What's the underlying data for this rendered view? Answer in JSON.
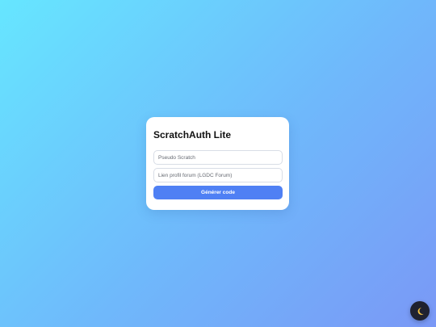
{
  "card": {
    "title": "ScratchAuth Lite",
    "username_placeholder": "Pseudo Scratch",
    "profile_link_placeholder": "Lien profil forum (LGDC Forum)",
    "submit_label": "Générer code"
  },
  "theme_toggle": {
    "icon": "moon-icon",
    "icon_color": "#f5c542"
  },
  "colors": {
    "background_start": "#66e6ff",
    "background_end": "#7a98f6",
    "accent": "#4f80f4",
    "toggle_bg": "#1f2230"
  }
}
